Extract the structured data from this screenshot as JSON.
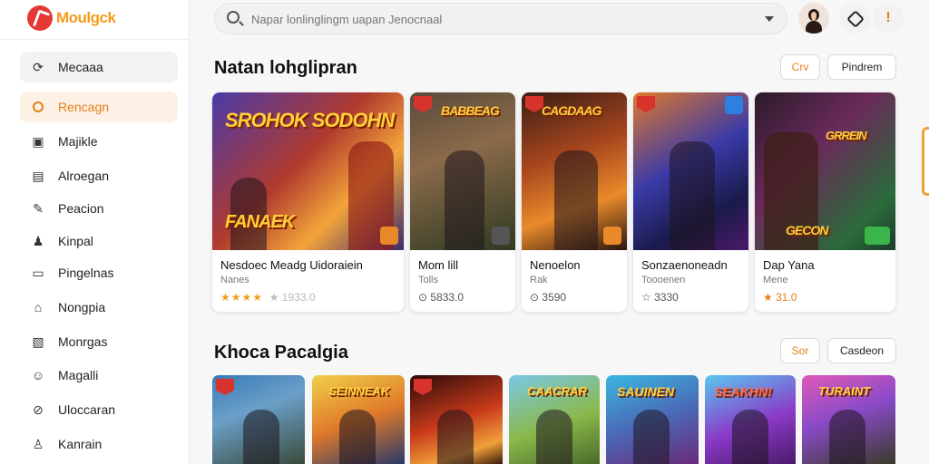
{
  "brand": {
    "name": "Moulgck"
  },
  "search": {
    "placeholder": "Napar lonlinglingm uapan Jenocnaal"
  },
  "sidebar": {
    "items": [
      {
        "label": "Mecaaa",
        "icon": "refresh-icon"
      },
      {
        "label": "Rencagn",
        "icon": "circle-icon"
      },
      {
        "label": "Majikle",
        "icon": "chat-icon"
      },
      {
        "label": "Alroegan",
        "icon": "calendar-icon"
      },
      {
        "label": "Peacion",
        "icon": "edit-icon"
      },
      {
        "label": "Kinpal",
        "icon": "user-icon"
      },
      {
        "label": "Pingelnas",
        "icon": "card-icon"
      },
      {
        "label": "Nongpia",
        "icon": "home-icon"
      },
      {
        "label": "Monrgas",
        "icon": "book-icon"
      },
      {
        "label": "Magalli",
        "icon": "person-icon"
      },
      {
        "label": "Uloccaran",
        "icon": "link-icon"
      },
      {
        "label": "Kanrain",
        "icon": "profile-icon"
      }
    ]
  },
  "section1": {
    "title": "Natan lohglipran",
    "btn1": "Crv",
    "btn2": "Pindrem",
    "cards": [
      {
        "logo": "SROHOK SODOHN",
        "logo2": "FANAEK",
        "title": "Nesdoec Meadg Uidoraiein",
        "sub": "Nanes",
        "stars": "★★★★",
        "rating": "★ 1933.0"
      },
      {
        "logo": "BABBEAG",
        "title": "Mom lill",
        "sub": "Tolls",
        "stars": "",
        "rating": "⊙ 5833.0"
      },
      {
        "logo": "CAGDAAG",
        "title": "Nenoelon",
        "sub": "Rak",
        "stars": "",
        "rating": "⊙ 3590"
      },
      {
        "logo": "",
        "title": "Sonzaenoneadn",
        "sub": "Toooenen",
        "stars": "",
        "rating": "☆ 3330"
      },
      {
        "logo": "GRREIN",
        "logo2": "GECON",
        "title": "Dap Yana",
        "sub": "Mene",
        "stars": "★",
        "rating": "★ 31.0"
      }
    ]
  },
  "section2": {
    "title": "Khoca Pacalgia",
    "btn1": "Sor",
    "btn2": "Casdeon",
    "tiles": [
      {
        "logo": ""
      },
      {
        "logo": "SEINNEAK"
      },
      {
        "logo": ""
      },
      {
        "logo": "CAACRAR"
      },
      {
        "logo": "SAUINEN"
      },
      {
        "logo": "SEAKHN!"
      },
      {
        "logo": "TURAINT"
      }
    ]
  }
}
